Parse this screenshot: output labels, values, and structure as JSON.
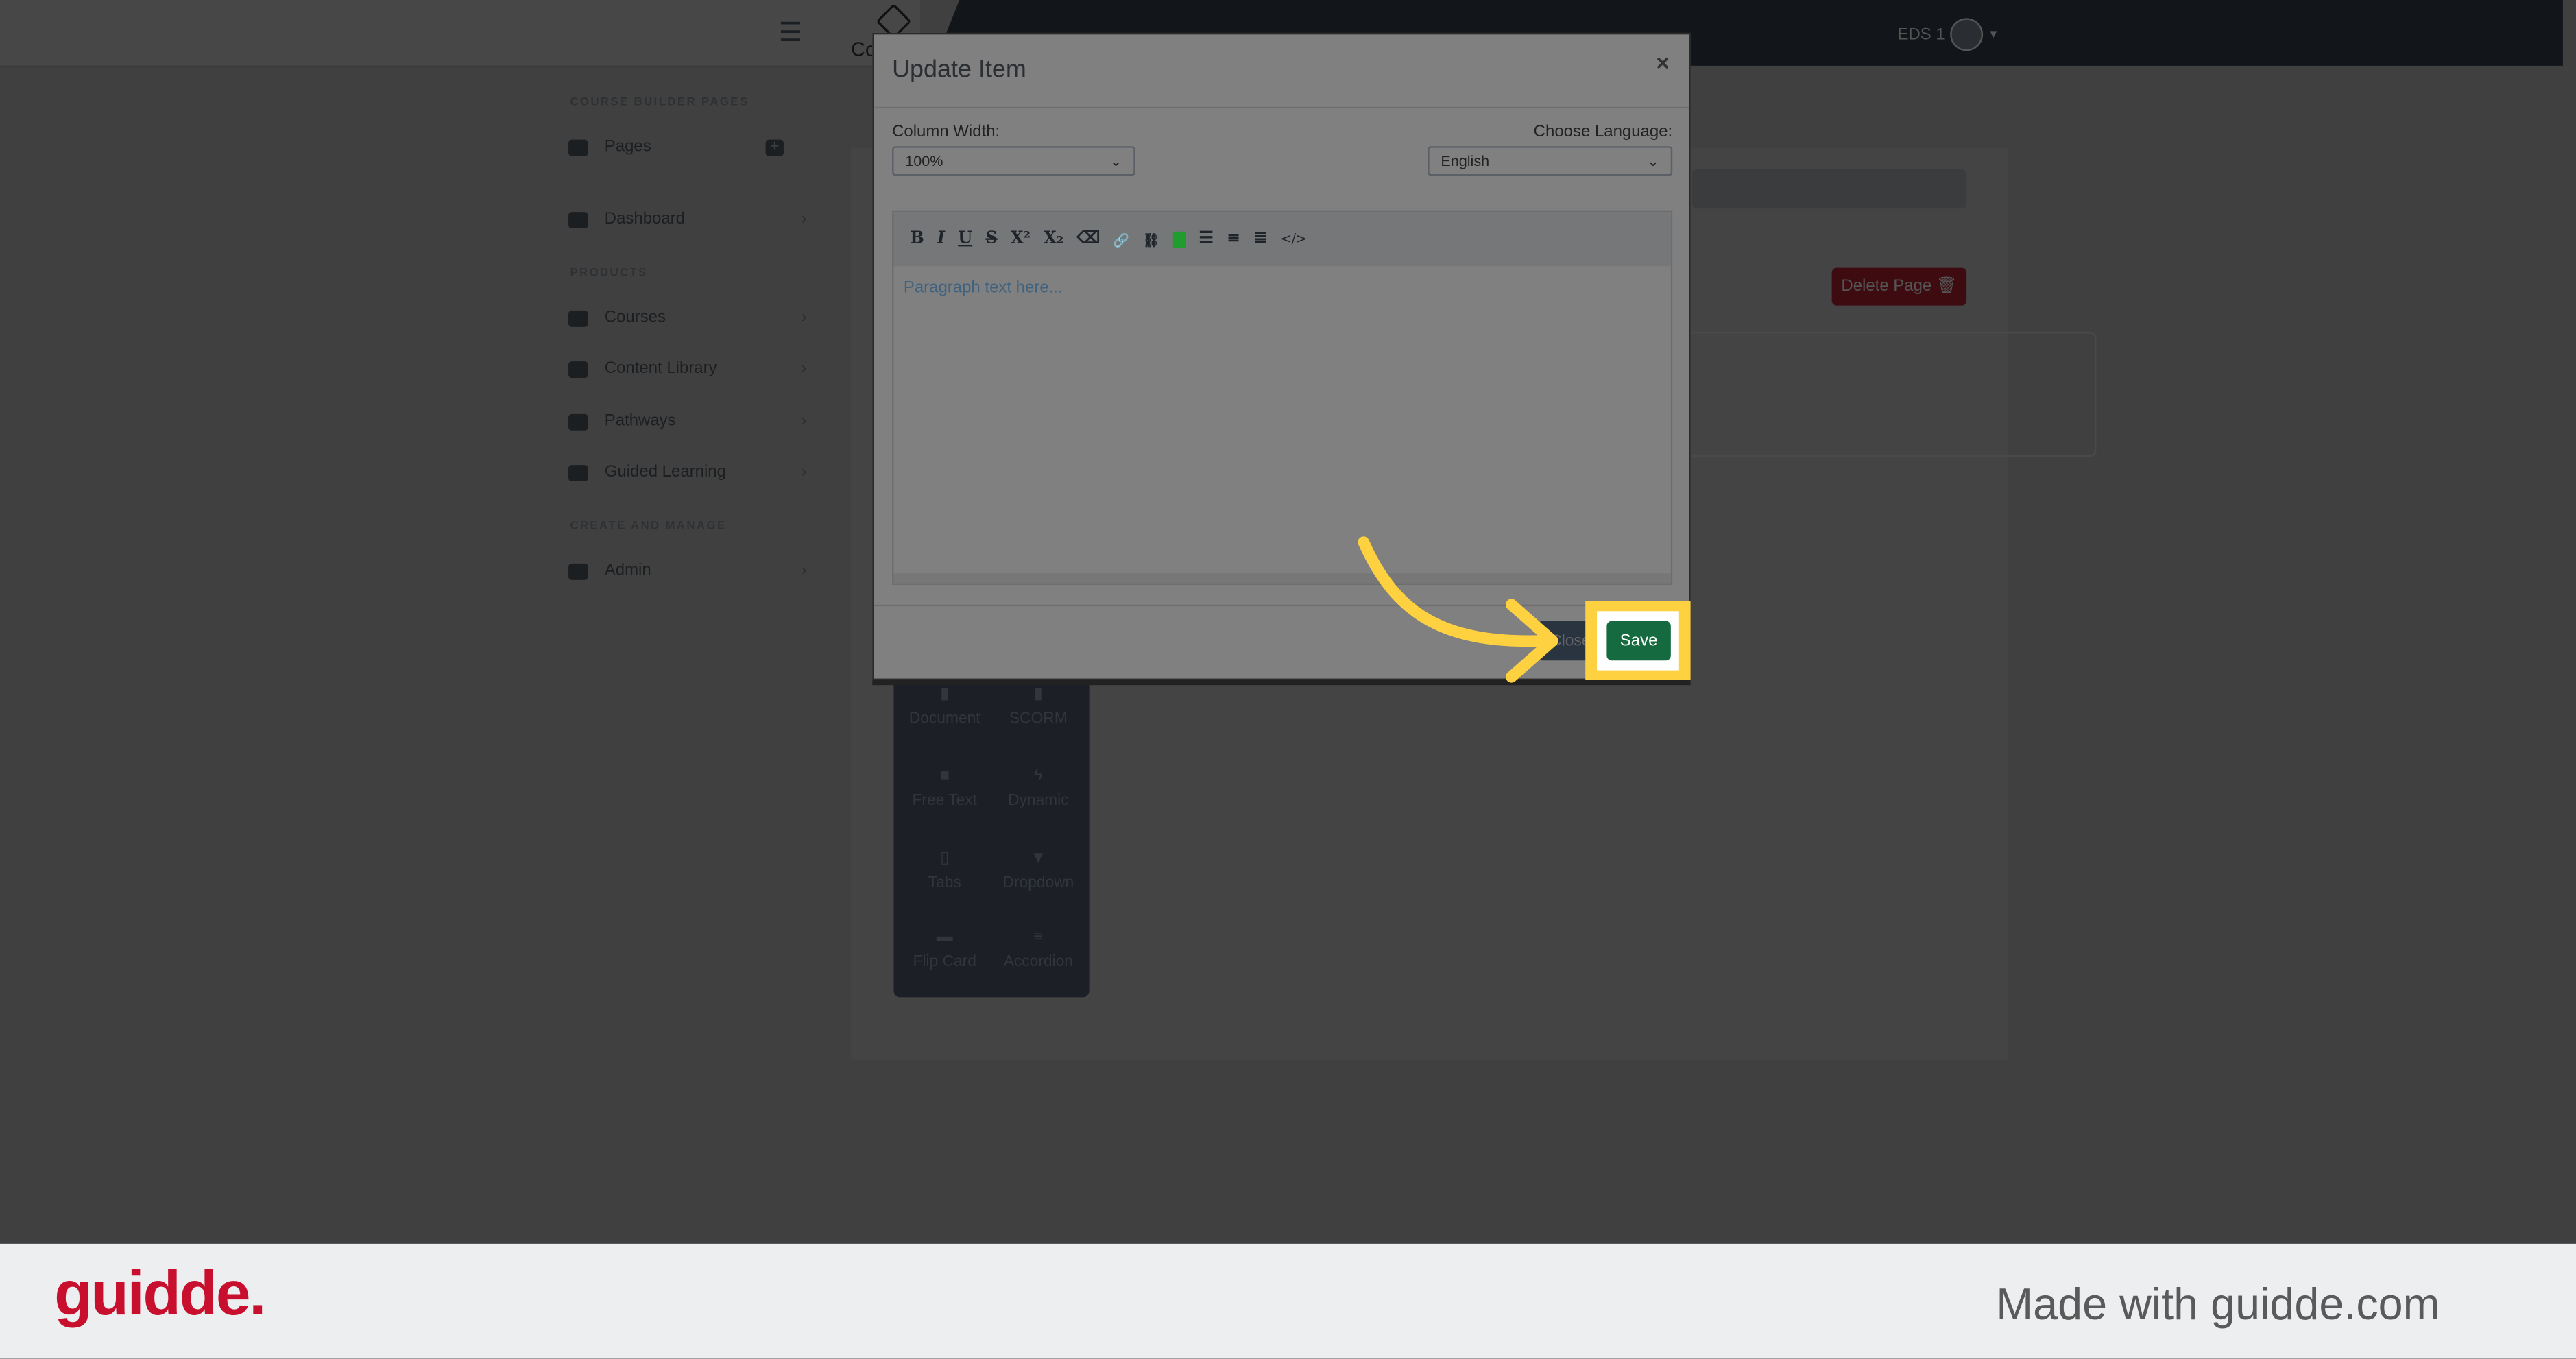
{
  "header": {
    "logo_text": "Co",
    "user_name": "EDS 1"
  },
  "sidebar": {
    "sections": [
      "COURSE BUILDER PAGES",
      "PRODUCTS",
      "CREATE AND MANAGE"
    ],
    "items": [
      {
        "label": "Pages",
        "icon": "bank-icon"
      },
      {
        "label": "Dashboard",
        "icon": "gauge-icon"
      },
      {
        "label": "Courses",
        "icon": "chalkboard-teacher-icon"
      },
      {
        "label": "Content Library",
        "icon": "book-icon"
      },
      {
        "label": "Pathways",
        "icon": "award-icon"
      },
      {
        "label": "Guided Learning",
        "icon": "clipboard-list-icon"
      },
      {
        "label": "Admin",
        "icon": "gear-icon"
      }
    ]
  },
  "main": {
    "delete_page_label": "Delete Page"
  },
  "palette": {
    "items": [
      "Document",
      "SCORM",
      "Free Text",
      "Dynamic",
      "Tabs",
      "Dropdown",
      "Flip Card",
      "Accordion"
    ]
  },
  "modal": {
    "title": "Update Item",
    "close_symbol": "×",
    "column_width_label": "Column Width:",
    "column_width_value": "100%",
    "language_label": "Choose Language:",
    "language_value": "English",
    "toolbar": [
      "B",
      "I",
      "U",
      "S",
      "X²",
      "X₂",
      "⌫",
      "🔗",
      "⛓",
      "A",
      "☰",
      "≡",
      "≣",
      "</>"
    ],
    "placeholder": "Paragraph text here...",
    "close_label": "Close",
    "save_label": "Save"
  },
  "colors": {
    "save": "#156a3f",
    "highlight": "#fdd13f",
    "brand": "#c8102e",
    "text_color_swatch": "#1f9d2e"
  },
  "footer": {
    "brand": "guidde.",
    "made_with": "Made with guidde.com"
  }
}
